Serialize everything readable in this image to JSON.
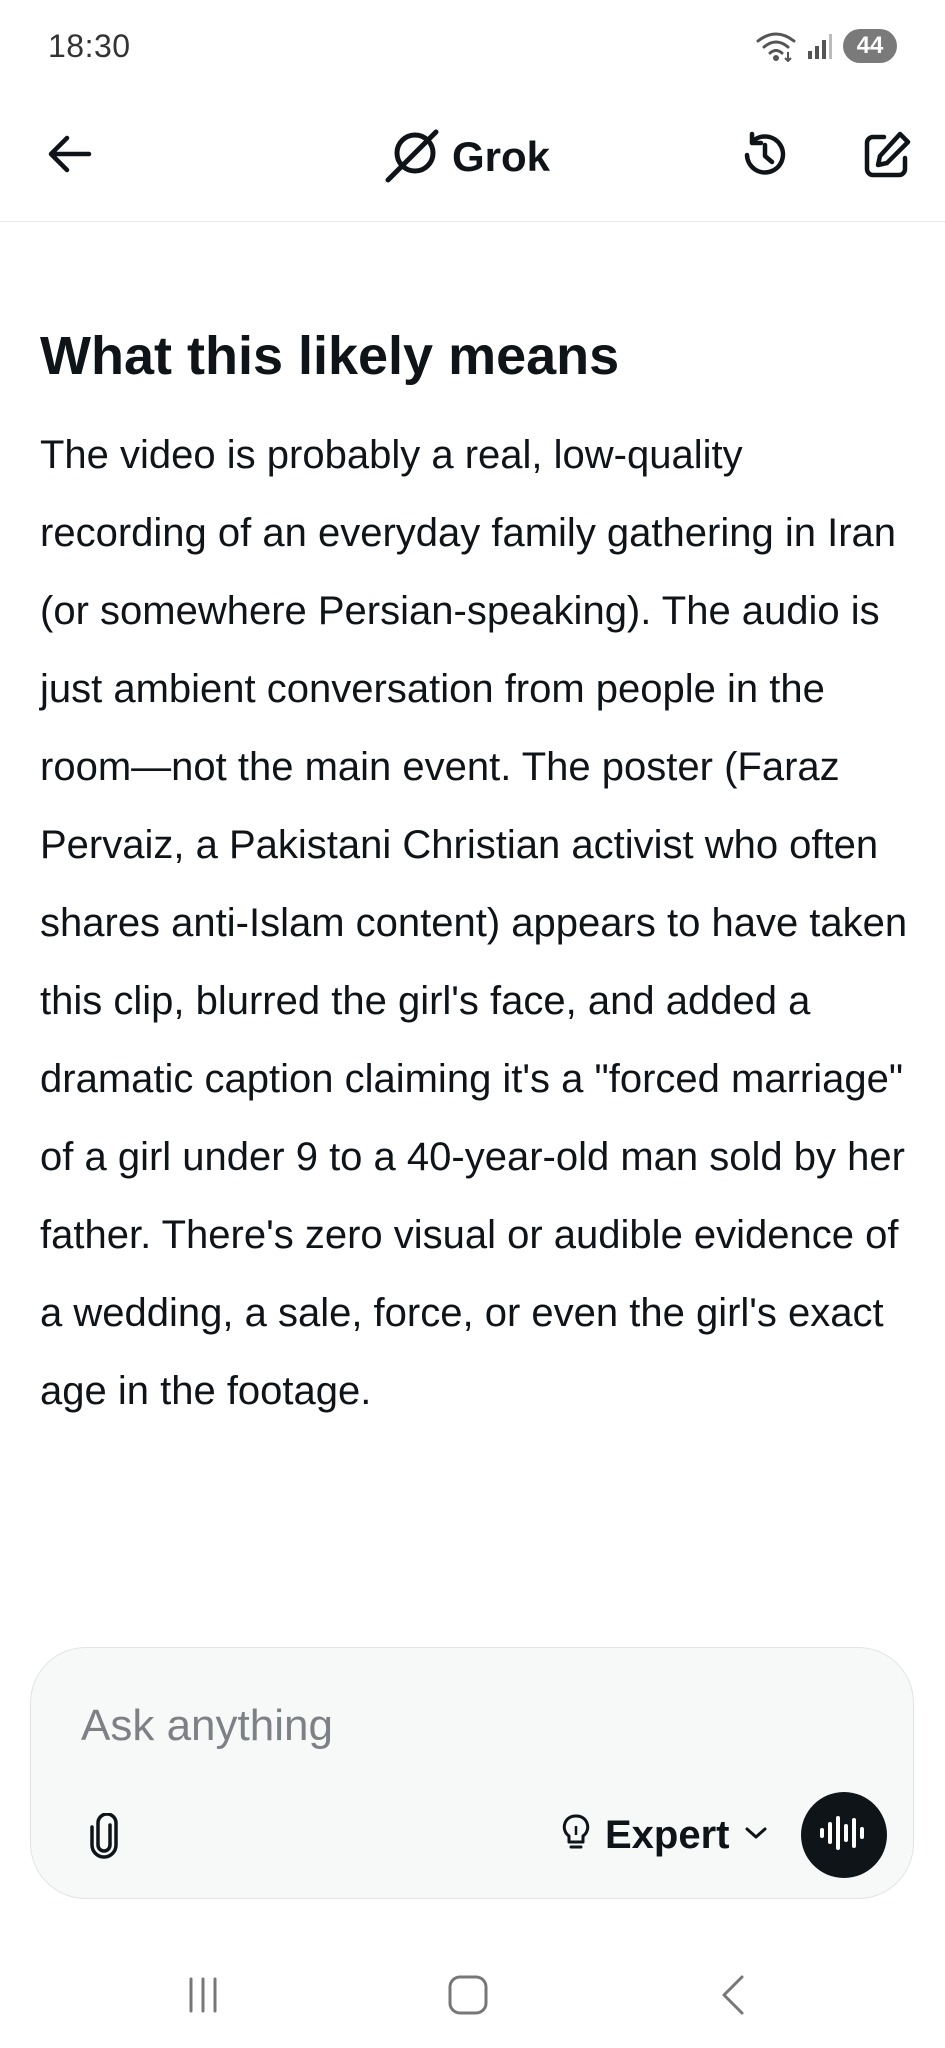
{
  "status_bar": {
    "time": "18:30",
    "battery": "44"
  },
  "header": {
    "back_icon": "arrow-left-icon",
    "brand_icon": "grok-logo-icon",
    "title": "Grok",
    "history_icon": "history-icon",
    "compose_icon": "edit-icon"
  },
  "content": {
    "heading": "What this likely means",
    "paragraph": "The video is probably a real, low-quality recording of an everyday family gathering in Iran (or somewhere Persian-speaking). The audio is just ambient conversation from people in the room—not the main event. The poster (Faraz Pervaiz, a Pakistani Christian activist who often shares anti-Islam content) appears to have taken this clip, blurred the girl's face, and added a dramatic caption claiming it's a \"forced marriage\" of a girl under 9 to a 40-year-old man sold by her father. There's zero visual or audible evidence of a wedding, a sale, force, or even the girl's exact age in the footage."
  },
  "composer": {
    "placeholder": "Ask anything",
    "attach_icon": "paperclip-icon",
    "mode_icon": "lightbulb-icon",
    "mode_label": "Expert",
    "mode_chevron_icon": "chevron-down-icon",
    "voice_icon": "voice-waveform-icon"
  },
  "nav_bar": {
    "recents_icon": "recents-icon",
    "home_icon": "home-icon",
    "back_icon": "back-chevron-icon"
  },
  "colors": {
    "text": "#0f1419",
    "composer_bg": "#f7f8f8",
    "voice_button": "#0f1419"
  }
}
